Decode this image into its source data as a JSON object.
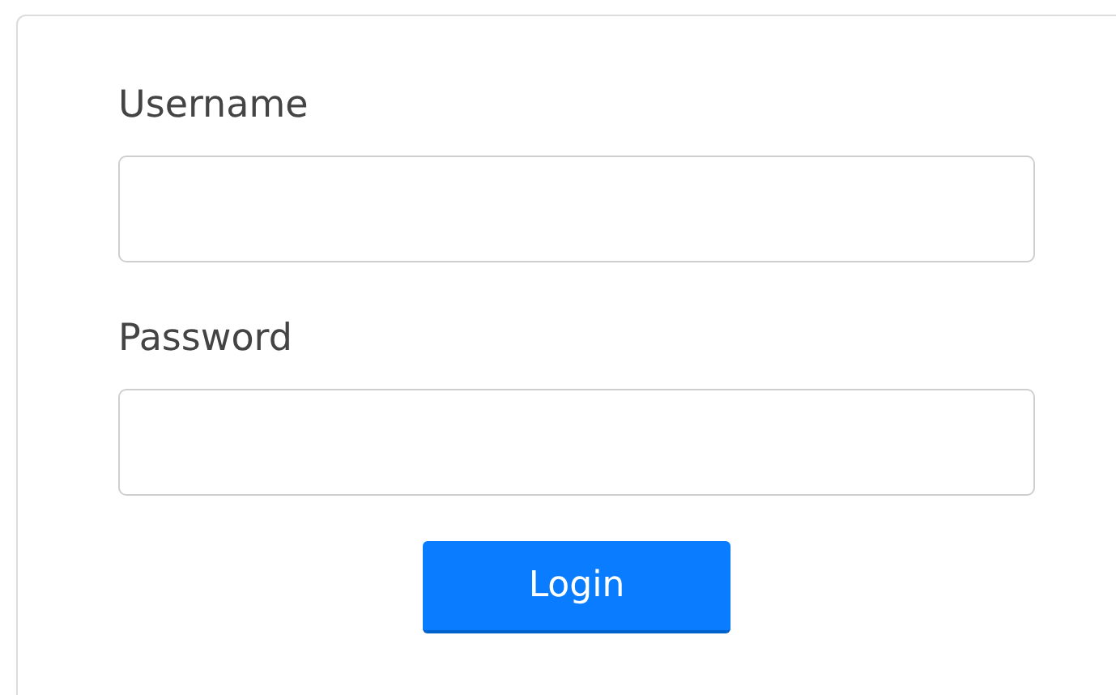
{
  "fields": [
    {
      "label": "Username"
    },
    {
      "label": "Password"
    }
  ],
  "login_button": {
    "label": "Login"
  }
}
